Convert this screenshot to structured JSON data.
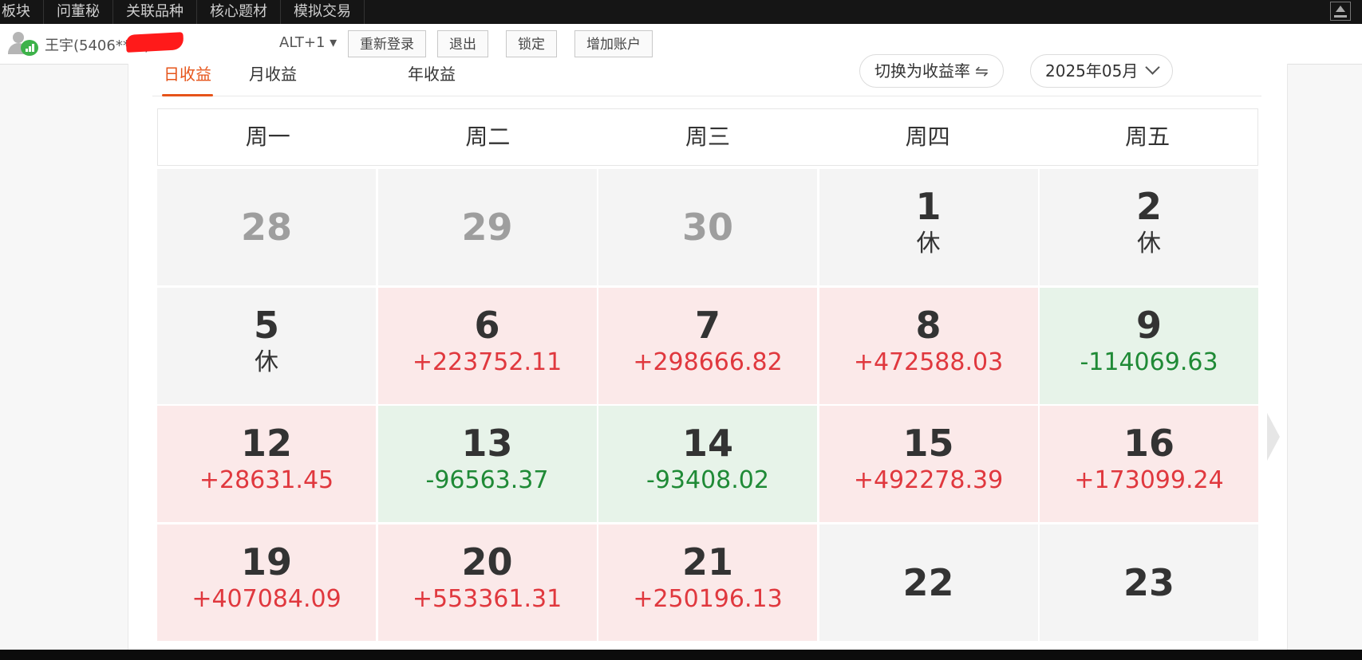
{
  "topbar": {
    "menu": [
      "板块",
      "问董秘",
      "关联品种",
      "核心题材",
      "模拟交易"
    ]
  },
  "account": {
    "name": "王宇(5406****)",
    "hotkey": "ALT+1 ▾",
    "buttons": [
      "重新登录",
      "退出",
      "锁定",
      "增加账户"
    ]
  },
  "tabs": [
    "日收益",
    "月收益",
    "年收益"
  ],
  "active_tab": "日收益",
  "toggle_label": "切换为收益率",
  "toggle_icon": "⇋",
  "month_selector": "2025年05月",
  "weekdays": [
    "周一",
    "周二",
    "周三",
    "周四",
    "周五"
  ],
  "calendar": [
    [
      {
        "day": "28",
        "sub": "",
        "kind": "gray-dim"
      },
      {
        "day": "29",
        "sub": "",
        "kind": "gray-dim"
      },
      {
        "day": "30",
        "sub": "",
        "kind": "gray-dim"
      },
      {
        "day": "1",
        "sub": "休",
        "kind": "rest"
      },
      {
        "day": "2",
        "sub": "休",
        "kind": "rest"
      }
    ],
    [
      {
        "day": "5",
        "sub": "休",
        "kind": "rest"
      },
      {
        "day": "6",
        "sub": "+223752.11",
        "kind": "pos"
      },
      {
        "day": "7",
        "sub": "+298666.82",
        "kind": "pos"
      },
      {
        "day": "8",
        "sub": "+472588.03",
        "kind": "pos"
      },
      {
        "day": "9",
        "sub": "-114069.63",
        "kind": "neg"
      }
    ],
    [
      {
        "day": "12",
        "sub": "+28631.45",
        "kind": "pos"
      },
      {
        "day": "13",
        "sub": "-96563.37",
        "kind": "neg"
      },
      {
        "day": "14",
        "sub": "-93408.02",
        "kind": "neg"
      },
      {
        "day": "15",
        "sub": "+492278.39",
        "kind": "pos"
      },
      {
        "day": "16",
        "sub": "+173099.24",
        "kind": "pos"
      }
    ],
    [
      {
        "day": "19",
        "sub": "+407084.09",
        "kind": "pos"
      },
      {
        "day": "20",
        "sub": "+553361.31",
        "kind": "pos"
      },
      {
        "day": "21",
        "sub": "+250196.13",
        "kind": "pos"
      },
      {
        "day": "22",
        "sub": "",
        "kind": "gray"
      },
      {
        "day": "23",
        "sub": "",
        "kind": "gray"
      }
    ]
  ],
  "colors": {
    "accent": "#e6541a",
    "positive": "#e0383e",
    "negative": "#1f8a36",
    "positive_bg": "#fbe9e9",
    "negative_bg": "#e7f3e9",
    "neutral_bg": "#f4f4f4"
  },
  "icons": {
    "avatar": "user-signal-icon",
    "upload": "upload-icon",
    "next": "chevron-right-icon"
  }
}
